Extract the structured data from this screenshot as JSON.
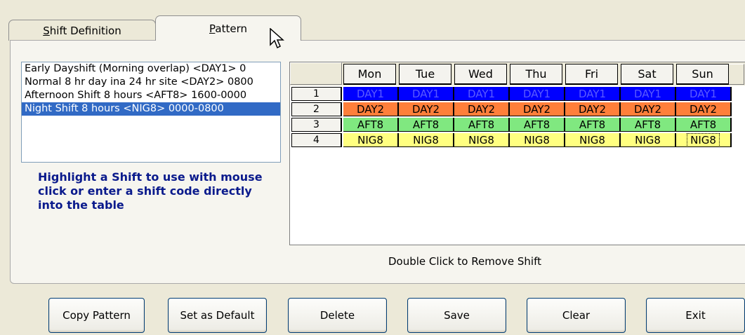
{
  "tabs": [
    {
      "label_pre": "",
      "label_ul": "S",
      "label_post": "hift Definition"
    },
    {
      "label_pre": "",
      "label_ul": "P",
      "label_post": "attern"
    }
  ],
  "shift_list": {
    "items": [
      "Early Dayshift (Morning overlap) <DAY1> 0",
      "Normal 8 hr day ina 24 hr site <DAY2> 0800",
      "Afternoon Shift 8 hours <AFT8> 1600-0000",
      "Night Shift 8 hours <NIG8> 0000-0800"
    ],
    "selected_index": 3
  },
  "hint": "Highlight a Shift to use with mouse click or enter a shift code directly into the table",
  "grid": {
    "columns": [
      "Mon",
      "Tue",
      "Wed",
      "Thu",
      "Fri",
      "Sat",
      "Sun"
    ],
    "rows": [
      {
        "num": "1",
        "code": "DAY1",
        "bg": "#0000ff",
        "fg": "#5a5aff"
      },
      {
        "num": "2",
        "code": "DAY2",
        "bg": "#ff7f3a",
        "fg": "#000000"
      },
      {
        "num": "3",
        "code": "AFT8",
        "bg": "#80e880",
        "fg": "#000000"
      },
      {
        "num": "4",
        "code": "NIG8",
        "bg": "#ffff80",
        "fg": "#000000"
      }
    ],
    "caption": "Double Click to Remove Shift"
  },
  "buttons": {
    "copy_pattern": "Copy Pattern",
    "set_default": "Set as Default",
    "delete": "Delete",
    "save": "Save",
    "clear": "Clear",
    "exit": "Exit"
  }
}
